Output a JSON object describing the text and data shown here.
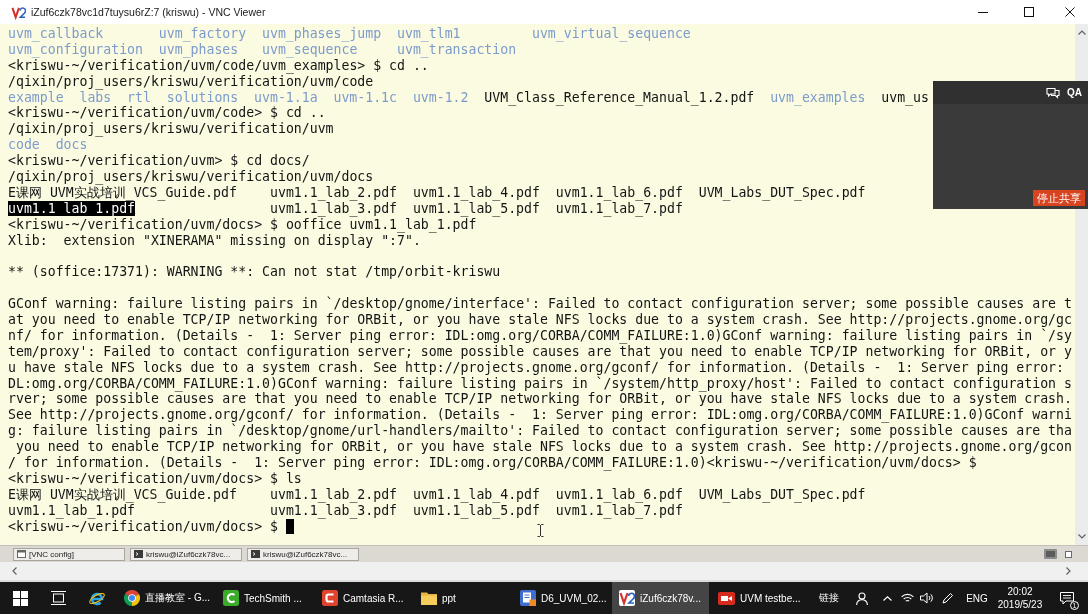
{
  "window": {
    "title": "iZuf6czk78vc1d7tuysu6rZ:7 (kriswu) - VNC Viewer"
  },
  "terminal": {
    "lines": [
      {
        "kind": "listing",
        "rows": [
          [
            {
              "name": "uvm_callback",
              "kind": "dir"
            },
            {
              "name": "uvm_factory",
              "kind": "dir"
            },
            {
              "name": "uvm_phases_jump",
              "kind": "dir"
            },
            {
              "name": "uvm_tlm1",
              "kind": "dir"
            },
            {
              "name": "uvm_virtual_sequence",
              "kind": "dir"
            }
          ],
          [
            {
              "name": "uvm_configuration",
              "kind": "dir"
            },
            {
              "name": "uvm_phases",
              "kind": "dir"
            },
            {
              "name": "uvm_sequence",
              "kind": "dir"
            },
            {
              "name": "uvm_transaction",
              "kind": "dir"
            }
          ]
        ]
      },
      {
        "kind": "text",
        "text": "<kriswu-~/verification/uvm/code/uvm_examples> $ cd .."
      },
      {
        "kind": "text",
        "text": "/qixin/proj_users/kriswu/verification/uvm/code"
      },
      {
        "kind": "listing",
        "rows": [
          [
            {
              "name": "example",
              "kind": "dir"
            },
            {
              "name": "labs",
              "kind": "dir"
            },
            {
              "name": "rtl",
              "kind": "dir"
            },
            {
              "name": "solutions",
              "kind": "dir"
            },
            {
              "name": "uvm-1.1a",
              "kind": "dir"
            },
            {
              "name": "uvm-1.1c",
              "kind": "dir"
            },
            {
              "name": "uvm-1.2",
              "kind": "dir"
            },
            {
              "name": "UVM_Class_Reference_Manual_1.2.pdf",
              "kind": "file"
            },
            {
              "name": "uvm_examples",
              "kind": "dir"
            },
            {
              "name": "uvm_us",
              "kind": "file"
            }
          ]
        ]
      },
      {
        "kind": "text",
        "text": "<kriswu-~/verification/uvm/code> $ cd .."
      },
      {
        "kind": "text",
        "text": "/qixin/proj_users/kriswu/verification/uvm"
      },
      {
        "kind": "listing",
        "rows": [
          [
            {
              "name": "code",
              "kind": "dir"
            },
            {
              "name": "docs",
              "kind": "dir"
            }
          ]
        ]
      },
      {
        "kind": "text",
        "text": "<kriswu-~/verification/uvm> $ cd docs/"
      },
      {
        "kind": "text",
        "text": "/qixin/proj_users/kriswu/verification/uvm/docs"
      },
      {
        "kind": "listing",
        "rows": [
          [
            {
              "name": "E课网 UVM实战培训_VCS_Guide.pdf",
              "kind": "file",
              "highlighted": false
            },
            {
              "name": "uvm1.1_lab_2.pdf",
              "kind": "file",
              "highlighted": false
            },
            {
              "name": "uvm1.1_lab_4.pdf",
              "kind": "file",
              "highlighted": false
            },
            {
              "name": "uvm1.1_lab_6.pdf",
              "kind": "file",
              "highlighted": false
            },
            {
              "name": "UVM_Labs_DUT_Spec.pdf",
              "kind": "file",
              "highlighted": false
            }
          ],
          [
            {
              "name": "uvm1.1_lab_1.pdf",
              "kind": "file",
              "highlighted": true
            },
            {
              "name": "uvm1.1_lab_3.pdf",
              "kind": "file",
              "highlighted": false
            },
            {
              "name": "uvm1.1_lab_5.pdf",
              "kind": "file",
              "highlighted": false
            },
            {
              "name": "uvm1.1_lab_7.pdf",
              "kind": "file",
              "highlighted": false
            }
          ]
        ]
      },
      {
        "kind": "text",
        "text": "<kriswu-~/verification/uvm/docs> $ ooffice uvm1.1_lab_1.pdf"
      },
      {
        "kind": "text",
        "text": "Xlib:  extension \"XINERAMA\" missing on display \":7\"."
      },
      {
        "kind": "blank"
      },
      {
        "kind": "text",
        "text": "** (soffice:17371): WARNING **: Can not stat /tmp/orbit-kriswu"
      },
      {
        "kind": "blank"
      },
      {
        "kind": "text",
        "text": "GConf warning: failure listing pairs in `/desktop/gnome/interface': Failed to contact configuration server; some possible causes are t"
      },
      {
        "kind": "text",
        "text": "at you need to enable TCP/IP networking for ORBit, or you have stale NFS locks due to a system crash. See http://projects.gnome.org/gc"
      },
      {
        "kind": "text",
        "text": "nf/ for information. (Details -  1: Server ping error: IDL:omg.org/CORBA/COMM_FAILURE:1.0)GConf warning: failure listing pairs in `/sy"
      },
      {
        "kind": "text",
        "text": "tem/proxy': Failed to contact configuration server; some possible causes are that you need to enable TCP/IP networking for ORBit, or y"
      },
      {
        "kind": "text",
        "text": "u have stale NFS locks due to a system crash. See http://projects.gnome.org/gconf/ for information. (Details -  1: Server ping error:"
      },
      {
        "kind": "text",
        "text": "DL:omg.org/CORBA/COMM_FAILURE:1.0)GConf warning: failure listing pairs in `/system/http_proxy/host': Failed to contact configuration s"
      },
      {
        "kind": "text",
        "text": "rver; some possible causes are that you need to enable TCP/IP networking for ORBit, or you have stale NFS locks due to a system crash."
      },
      {
        "kind": "text",
        "text": "See http://projects.gnome.org/gconf/ for information. (Details -  1: Server ping error: IDL:omg.org/CORBA/COMM_FAILURE:1.0)GConf warni"
      },
      {
        "kind": "text",
        "text": "g: failure listing pairs in `/desktop/gnome/url-handlers/mailto': Failed to contact configuration server; some possible causes are tha"
      },
      {
        "kind": "text",
        "text": " you need to enable TCP/IP networking for ORBit, or you have stale NFS locks due to a system crash. See http://projects.gnome.org/gcon"
      },
      {
        "kind": "text",
        "text": "/ for information. (Details -  1: Server ping error: IDL:omg.org/CORBA/COMM_FAILURE:1.0)<kriswu-~/verification/uvm/docs> $"
      },
      {
        "kind": "text",
        "text": "<kriswu-~/verification/uvm/docs> $ ls"
      },
      {
        "kind": "listing",
        "rows": [
          [
            {
              "name": "E课网 UVM实战培训_VCS_Guide.pdf",
              "kind": "file"
            },
            {
              "name": "uvm1.1_lab_2.pdf",
              "kind": "file"
            },
            {
              "name": "uvm1.1_lab_4.pdf",
              "kind": "file"
            },
            {
              "name": "uvm1.1_lab_6.pdf",
              "kind": "file"
            },
            {
              "name": "UVM_Labs_DUT_Spec.pdf",
              "kind": "file"
            }
          ],
          [
            {
              "name": "uvm1.1_lab_1.pdf",
              "kind": "file"
            },
            {
              "name": "uvm1.1_lab_3.pdf",
              "kind": "file"
            },
            {
              "name": "uvm1.1_lab_5.pdf",
              "kind": "file"
            },
            {
              "name": "uvm1.1_lab_7.pdf",
              "kind": "file"
            }
          ]
        ]
      },
      {
        "kind": "active_prompt",
        "text": "<kriswu-~/verification/uvm/docs> $"
      }
    ]
  },
  "share_panel": {
    "qa_button": "QA",
    "stop_button": "停止共享"
  },
  "remote_panel": {
    "tasks": [
      {
        "label": "[VNC config]",
        "kind": "config"
      },
      {
        "label": "kriswu@iZuf6czk78vc...",
        "kind": "terminal"
      },
      {
        "label": "kriswu@iZuf6czk78vc...",
        "kind": "terminal"
      }
    ]
  },
  "taskbar": {
    "apps": [
      {
        "label": "直播教室 - G...",
        "kind": "browser",
        "selected": false
      },
      {
        "label": "TechSmith ...",
        "kind": "recorder",
        "selected": false
      },
      {
        "label": "Camtasia R...",
        "kind": "editor",
        "selected": false
      },
      {
        "label": "ppt",
        "kind": "folder",
        "selected": false
      },
      {
        "label": "D6_UVM_02...",
        "kind": "document",
        "selected": false
      },
      {
        "label": "iZuf6czk78v...",
        "kind": "viewer",
        "selected": true
      },
      {
        "label": "UVM testbe...",
        "kind": "video",
        "selected": false
      }
    ],
    "links_label": "链接",
    "language": "ENG",
    "time": "20:02",
    "date": "2019/5/23",
    "notification_count": "1"
  }
}
